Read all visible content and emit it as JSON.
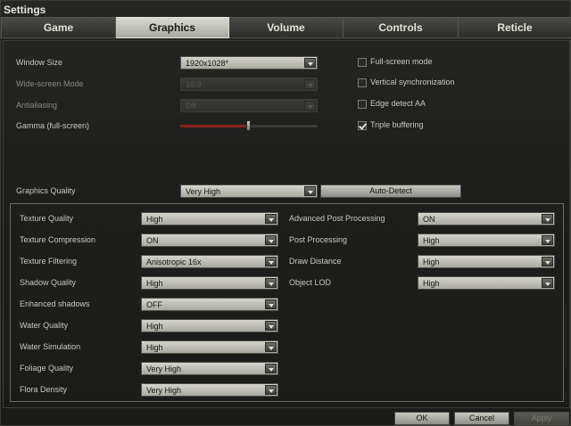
{
  "window": {
    "title": "Settings"
  },
  "tabs": [
    {
      "label": "Game",
      "active": false
    },
    {
      "label": "Graphics",
      "active": true
    },
    {
      "label": "Volume",
      "active": false
    },
    {
      "label": "Controls",
      "active": false
    },
    {
      "label": "Reticle",
      "active": false
    }
  ],
  "display": {
    "window_size": {
      "label": "Window Size",
      "value": "1920x1028*"
    },
    "wide_screen": {
      "label": "Wide-screen Mode",
      "value": "16:9",
      "disabled": true
    },
    "antialiasing": {
      "label": "Antialiasing",
      "value": "Off",
      "disabled": true
    },
    "gamma": {
      "label": "Gamma (full-screen)",
      "level_percent": 50
    }
  },
  "checkboxes": [
    {
      "label": "Full-screen mode",
      "checked": false
    },
    {
      "label": "Vertical synchronization",
      "checked": false
    },
    {
      "label": "Edge detect AA",
      "checked": false
    },
    {
      "label": "Triple buffering",
      "checked": true
    }
  ],
  "graphics_quality": {
    "label": "Graphics Quality",
    "value": "Very High",
    "auto_detect_label": "Auto-Detect"
  },
  "left_settings": [
    {
      "label": "Texture Quality",
      "value": "High"
    },
    {
      "label": "Texture Compression",
      "value": "ON"
    },
    {
      "label": "Texture Filtering",
      "value": "Anisotropic 16x"
    },
    {
      "label": "Shadow Quality",
      "value": "High"
    },
    {
      "label": "Enhanced shadows",
      "value": "OFF"
    },
    {
      "label": "Water Quality",
      "value": "High"
    },
    {
      "label": "Water Simulation",
      "value": "High"
    },
    {
      "label": "Foliage Quality",
      "value": "Very High"
    },
    {
      "label": "Flora Density",
      "value": "Very High"
    }
  ],
  "right_settings": [
    {
      "label": "Advanced Post Processing",
      "value": "ON"
    },
    {
      "label": "Post Processing",
      "value": "High"
    },
    {
      "label": "Draw Distance",
      "value": "High"
    },
    {
      "label": "Object LOD",
      "value": "High"
    }
  ],
  "footer": {
    "ok": "OK",
    "cancel": "Cancel",
    "apply": "Apply"
  },
  "colors": {
    "accent_slider": "#8a2418",
    "active_tab": "#c8c8c0"
  }
}
